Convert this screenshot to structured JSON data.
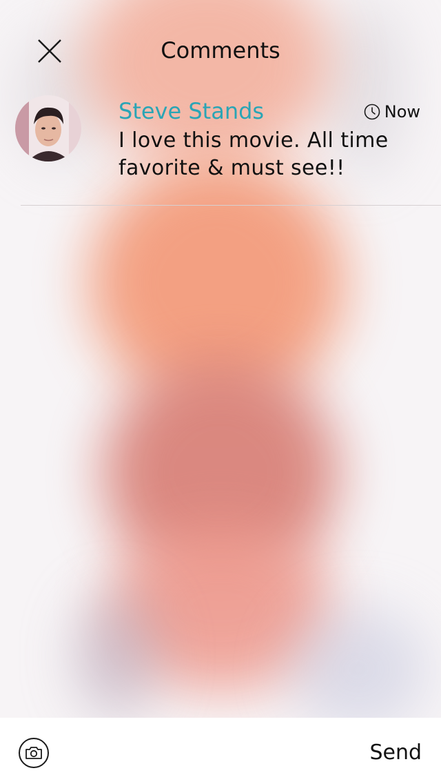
{
  "header": {
    "title": "Comments",
    "close_icon": "close-icon"
  },
  "comments": [
    {
      "author": "Steve Stands",
      "time": "Now",
      "text": "I love this movie. All time favorite & must see!!",
      "avatar_icon": "avatar"
    }
  ],
  "footer": {
    "camera_icon": "camera-icon",
    "send_label": "Send"
  },
  "colors": {
    "accent": "#2aa5b5",
    "text": "#111111",
    "divider": "#d6d0d2"
  }
}
